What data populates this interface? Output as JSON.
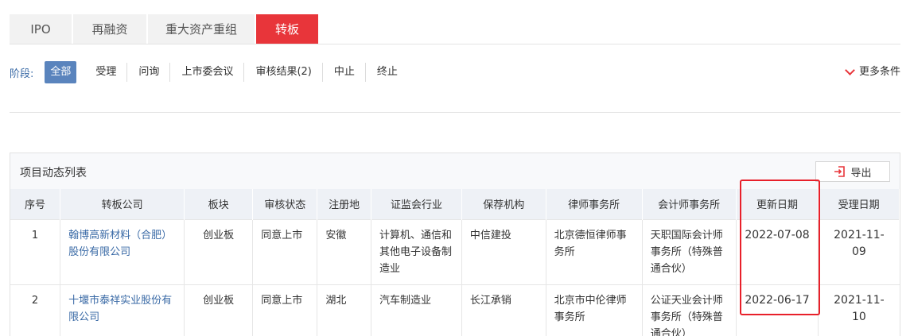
{
  "tabs": [
    {
      "label": "IPO"
    },
    {
      "label": "再融资"
    },
    {
      "label": "重大资产重组"
    },
    {
      "label": "转板"
    }
  ],
  "filter": {
    "label": "阶段:",
    "stages": [
      "全部",
      "受理",
      "问询",
      "上市委会议",
      "审核结果(2)",
      "中止",
      "终止"
    ],
    "more": "更多条件"
  },
  "panel": {
    "title": "项目动态列表",
    "export_label": "导出"
  },
  "table": {
    "headers": [
      "序号",
      "转板公司",
      "板块",
      "审核状态",
      "注册地",
      "证监会行业",
      "保荐机构",
      "律师事务所",
      "会计师事务所",
      "更新日期",
      "受理日期"
    ],
    "rows": [
      [
        "1",
        "翰博高新材料（合肥）股份有限公司",
        "创业板",
        "同意上市",
        "安徽",
        "计算机、通信和其他电子设备制造业",
        "中信建投",
        "北京德恒律师事务所",
        "天职国际会计师事务所（特殊普通合伙）",
        "2022-07-08",
        "2021-11-09"
      ],
      [
        "2",
        "十堰市泰祥实业股份有限公司",
        "创业板",
        "同意上市",
        "湖北",
        "汽车制造业",
        "长江承销",
        "北京市中伦律师事务所",
        "公证天业会计师事务所（特殊普通合伙）",
        "2022-06-17",
        "2021-11-10"
      ]
    ]
  },
  "colors": {
    "accent_red": "#e8353a",
    "link_blue": "#3a6aa6",
    "active_stage": "#5a84bd",
    "highlight": "#e8202a"
  }
}
